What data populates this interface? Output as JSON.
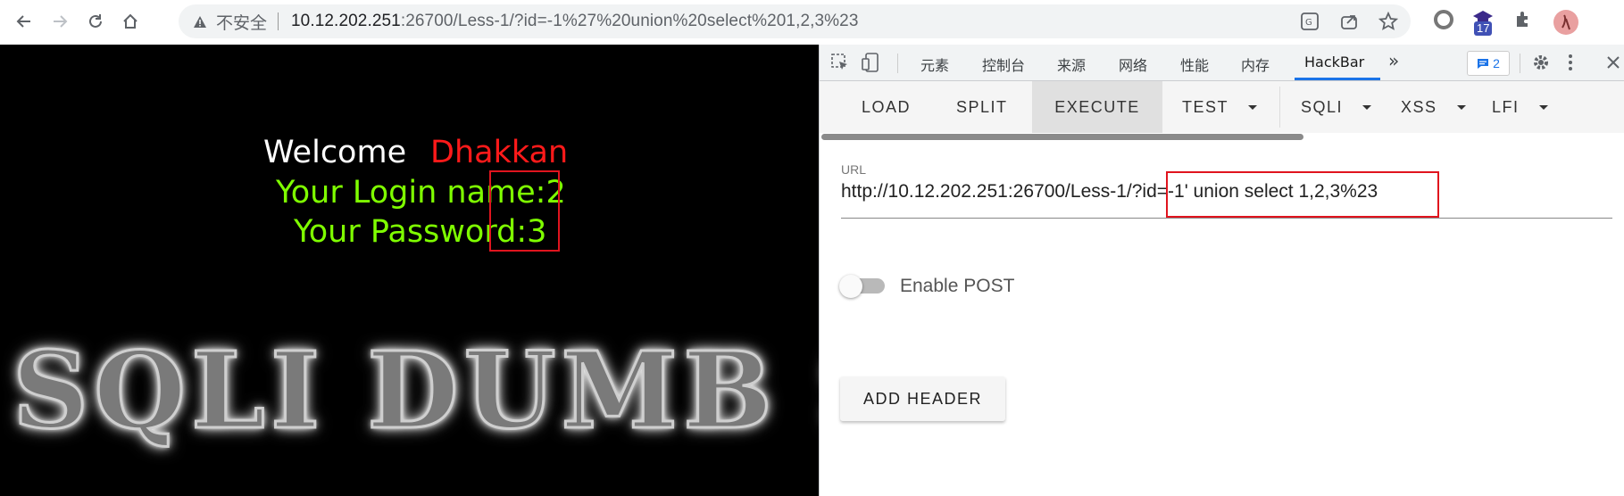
{
  "browser": {
    "insecure_label": "不安全",
    "url_host": "10.12.202.251",
    "url_path": ":26700/Less-1/?id=-1%27%20union%20select%201,2,3%23",
    "extension_badge": "17"
  },
  "page": {
    "welcome": "Welcome",
    "name": "Dhakkan",
    "login_line": "Your Login name:2",
    "password_line": "Your Password:3",
    "banner": "SQLI DUMB SERIES"
  },
  "devtools": {
    "tabs": [
      "元素",
      "控制台",
      "来源",
      "网络",
      "性能",
      "内存",
      "HackBar"
    ],
    "issues_count": "2"
  },
  "hackbar": {
    "buttons": [
      "LOAD",
      "SPLIT",
      "EXECUTE",
      "TEST",
      "SQLI",
      "XSS",
      "LFI"
    ],
    "url_label": "URL",
    "url_value": "http://10.12.202.251:26700/Less-1/?id=-1' union select 1,2,3%23",
    "enable_post_label": "Enable POST",
    "add_header_label": "ADD HEADER"
  }
}
